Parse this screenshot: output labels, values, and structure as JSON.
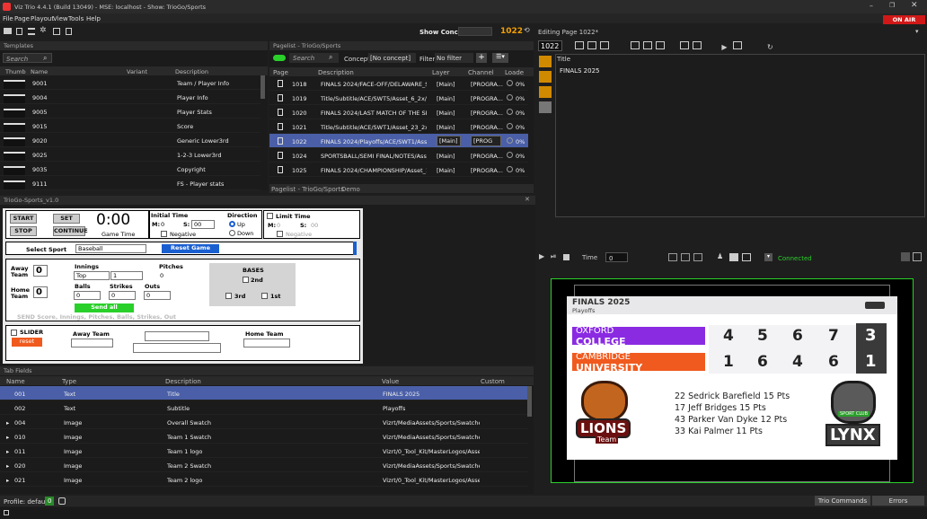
{
  "app": {
    "title": "Viz Trio 4.4.1 (Build 13049) - MSE: localhost - Show: TrioGo/Sports",
    "on_air": "ON AIR"
  },
  "menu": [
    "File",
    "Page",
    "Playout",
    "View",
    "Tools",
    "Help"
  ],
  "toolbar": {
    "show_concept_label": "Show Concept:",
    "page_number": "1022"
  },
  "templates": {
    "title": "Templates",
    "search_placeholder": "Search",
    "columns": [
      "Thumb",
      "Name",
      "Variant",
      "Description"
    ],
    "rows": [
      {
        "name": "9001",
        "desc": "Team / Player Info"
      },
      {
        "name": "9004",
        "desc": "Player Info"
      },
      {
        "name": "9005",
        "desc": "Player Stats"
      },
      {
        "name": "9015",
        "desc": "Score"
      },
      {
        "name": "9020",
        "desc": "Generic Lower3rd"
      },
      {
        "name": "9025",
        "desc": "1-2-3 Lower3rd"
      },
      {
        "name": "9035",
        "desc": "Copyright"
      },
      {
        "name": "9111",
        "desc": "FS - Player stats"
      }
    ]
  },
  "pagelist": {
    "title": "Pagelist - TrioGo/Sports",
    "search_placeholder": "Search",
    "concept_label": "Concept:",
    "concept_value": "[No concept]",
    "filter_label": "Filter:",
    "filter_value": "No filter",
    "columns": [
      "Page",
      "Description",
      "Layer",
      "Channel",
      "Loade"
    ],
    "rows": [
      {
        "page": "1018",
        "desc": "FINALS 2024/FACE-OFF/DELAWARE_ST/...",
        "layer": "[Main]",
        "channel": "[PROGRA...",
        "load": "0%"
      },
      {
        "page": "1019",
        "desc": "Title/Subtitle/ACE/SWT5/Asset_6_2x/FI...",
        "layer": "[Main]",
        "channel": "[PROGRA...",
        "load": "0%"
      },
      {
        "page": "1020",
        "desc": "FINALS 2024/LAST MATCH OF THE SEA...",
        "layer": "[Main]",
        "channel": "[PROGRA...",
        "load": "0%"
      },
      {
        "page": "1021",
        "desc": "Title/Subtitle/ACE/SWT1/Asset_23_2x/S...",
        "layer": "[Main]",
        "channel": "[PROGRA...",
        "load": "0%"
      },
      {
        "page": "1022",
        "desc": "FINALS 2024/Playoffs/ACE/SWT1/Asset...",
        "layer": "[Main]",
        "channel": "[PROG",
        "load": "0%"
      },
      {
        "page": "1024",
        "desc": "SPORTSBALL/SEMI FINAL/NOTES/Asset...",
        "layer": "[Main]",
        "channel": "[PROGRA...",
        "load": "0%"
      },
      {
        "page": "1025",
        "desc": "FINALS 2024/CHAMPIONSHIP/Asset_11...",
        "layer": "[Main]",
        "channel": "[PROGRA...",
        "load": "0%"
      }
    ],
    "tabs": [
      "Pagelist - TrioGo/Sports",
      "Demo"
    ]
  },
  "editing": {
    "title": "Editing Page 1022*",
    "page": "1022",
    "field_label": "Title",
    "field_value": "FINALS 2025"
  },
  "control": {
    "title": "TrioGo-Sports_v1.0",
    "start": "START",
    "set": "SET",
    "stop": "STOP",
    "continue": "CONTINUE",
    "clock": "0:00",
    "game_time": "Game Time",
    "initial_time": "Initial Time",
    "m_label": "M:",
    "m_val": "0",
    "s_label": "S:",
    "s_val": "00",
    "negative": "Negative",
    "direction": "Direction",
    "up": "Up",
    "down": "Down",
    "limit_time": "Limit Time",
    "select_sport": "Select Sport",
    "sport": "Baseball",
    "reset_game": "Reset Game",
    "away_team": "Away Team",
    "away_score": "0",
    "home_team": "Home Team",
    "home_score": "0",
    "innings": "Innings",
    "inning_half": "Top",
    "inning_num": "1",
    "pitches": "Pitches",
    "pitches_val": "0",
    "balls": "Balls",
    "strikes": "Strikes",
    "outs": "Outs",
    "zero": "0",
    "send_all": "Send all",
    "bases": "BASES",
    "b2": "2nd",
    "b3": "3rd",
    "b1": "1st",
    "send_note": "SEND Score, Innings, Pitches, Balls, Strikes, Out",
    "slider": "SLIDER",
    "reset": "reset",
    "away_team2": "Away Team",
    "home_team2": "Home Team"
  },
  "preview": {
    "time_label": "Time",
    "time_val": "0",
    "connected": "Connected",
    "gfx": {
      "title": "FINALS 2025",
      "subtitle": "Playoffs",
      "team1_l1": "OXFORD",
      "team1_l2": "COLLEGE",
      "team1_scores": [
        "4",
        "5",
        "6",
        "7"
      ],
      "team1_total": "3",
      "team2_l1": "CAMBRIDGE",
      "team2_l2": "UNIVERSITY",
      "team2_scores": [
        "1",
        "6",
        "4",
        "6"
      ],
      "team2_total": "1",
      "stats": [
        "22 Sedrick Barefield 15 Pts",
        "17 Jeff Bridges 15 Pts",
        "43 Parker Van Dyke 12 Pts",
        "33 Kai Palmer 11 Pts"
      ],
      "logo_left": "LIONS",
      "logo_left_sub": "Team",
      "logo_right": "LYNX",
      "logo_right_sub": "SPORT CLUB"
    }
  },
  "tabfields": {
    "title": "Tab Fields",
    "columns": [
      "Name",
      "Type",
      "Description",
      "Value",
      "Custom"
    ],
    "rows": [
      {
        "name": "001",
        "type": "Text",
        "desc": "Title",
        "value": "FINALS 2025",
        "exp": ""
      },
      {
        "name": "002",
        "type": "Text",
        "desc": "Subtitle",
        "value": "Playoffs",
        "exp": ""
      },
      {
        "name": "004",
        "type": "Image",
        "desc": "Overall Swatch",
        "value": "Vizrt/MediaAssets/Sports/Swatche...",
        "exp": "▸"
      },
      {
        "name": "010",
        "type": "Image",
        "desc": "Team 1 Swatch",
        "value": "Vizrt/MediaAssets/Sports/Swatche...",
        "exp": "▸"
      },
      {
        "name": "011",
        "type": "Image",
        "desc": "Team 1 logo",
        "value": "Vizrt/0_Tool_Kit/MasterLogos/Asse...",
        "exp": "▸"
      },
      {
        "name": "020",
        "type": "Image",
        "desc": "Team 2 Swatch",
        "value": "Vizrt/MediaAssets/Sports/Swatche...",
        "exp": "▸"
      },
      {
        "name": "021",
        "type": "Image",
        "desc": "Team 2 logo",
        "value": "Vizrt/0_Tool_Kit/MasterLogos/Asse...",
        "exp": "▸"
      }
    ]
  },
  "status": {
    "profile": "Profile: default",
    "profile_num": "0",
    "trio_commands": "Trio Commands",
    "errors": "Errors"
  },
  "colors": {
    "accent": "#4a5fa8",
    "on_air": "#d01818",
    "green": "#2ad02a",
    "orange": "#f05a1e",
    "purple": "#8a2be2"
  }
}
